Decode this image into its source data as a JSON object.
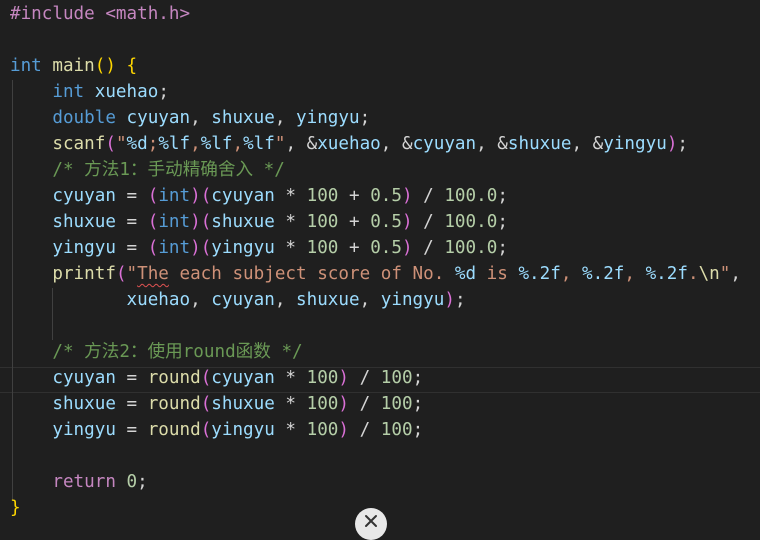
{
  "editor": {
    "colors": {
      "background": "#1f1f1f",
      "keyword": "#569cd6",
      "control": "#c586c0",
      "function": "#dcdcaa",
      "variable": "#9cdcfe",
      "string": "#ce9178",
      "number": "#b5cea8",
      "comment": "#6a9955",
      "bracket": "#ffd700",
      "bracket2": "#da70d6",
      "bracket3": "#179fff",
      "text": "#d4d4d4"
    },
    "lines": [
      [
        {
          "t": "#include <math.h>",
          "c": "control"
        }
      ],
      [],
      [
        {
          "t": "int",
          "c": "keyword"
        },
        {
          "t": " ",
          "c": "text"
        },
        {
          "t": "main",
          "c": "function"
        },
        {
          "t": "()",
          "c": "bracket"
        },
        {
          "t": " ",
          "c": "text"
        },
        {
          "t": "{",
          "c": "bracket"
        }
      ],
      [
        {
          "t": "    ",
          "c": "text"
        },
        {
          "t": "int",
          "c": "keyword"
        },
        {
          "t": " ",
          "c": "text"
        },
        {
          "t": "xuehao",
          "c": "variable"
        },
        {
          "t": ";",
          "c": "text"
        }
      ],
      [
        {
          "t": "    ",
          "c": "text"
        },
        {
          "t": "double",
          "c": "keyword"
        },
        {
          "t": " ",
          "c": "text"
        },
        {
          "t": "cyuyan",
          "c": "variable"
        },
        {
          "t": ", ",
          "c": "text"
        },
        {
          "t": "shuxue",
          "c": "variable"
        },
        {
          "t": ", ",
          "c": "text"
        },
        {
          "t": "yingyu",
          "c": "variable"
        },
        {
          "t": ";",
          "c": "text"
        }
      ],
      [
        {
          "t": "    ",
          "c": "text"
        },
        {
          "t": "scanf",
          "c": "function"
        },
        {
          "t": "(",
          "c": "bracket2"
        },
        {
          "t": "\"",
          "c": "string"
        },
        {
          "t": "%d",
          "c": "variable"
        },
        {
          "t": ";",
          "c": "string"
        },
        {
          "t": "%lf",
          "c": "variable"
        },
        {
          "t": ",",
          "c": "string"
        },
        {
          "t": "%lf",
          "c": "variable"
        },
        {
          "t": ",",
          "c": "string"
        },
        {
          "t": "%lf",
          "c": "variable"
        },
        {
          "t": "\"",
          "c": "string"
        },
        {
          "t": ", &",
          "c": "text"
        },
        {
          "t": "xuehao",
          "c": "variable"
        },
        {
          "t": ", &",
          "c": "text"
        },
        {
          "t": "cyuyan",
          "c": "variable"
        },
        {
          "t": ", &",
          "c": "text"
        },
        {
          "t": "shuxue",
          "c": "variable"
        },
        {
          "t": ", &",
          "c": "text"
        },
        {
          "t": "yingyu",
          "c": "variable"
        },
        {
          "t": ")",
          "c": "bracket2"
        },
        {
          "t": ";",
          "c": "text"
        }
      ],
      [
        {
          "t": "    ",
          "c": "text"
        },
        {
          "t": "/* 方法1：手动精确舍入 */",
          "c": "comment"
        }
      ],
      [
        {
          "t": "    ",
          "c": "text"
        },
        {
          "t": "cyuyan",
          "c": "variable"
        },
        {
          "t": " = ",
          "c": "text"
        },
        {
          "t": "(",
          "c": "bracket2"
        },
        {
          "t": "int",
          "c": "keyword"
        },
        {
          "t": ")",
          "c": "bracket2"
        },
        {
          "t": "(",
          "c": "bracket2"
        },
        {
          "t": "cyuyan",
          "c": "variable"
        },
        {
          "t": " * ",
          "c": "text"
        },
        {
          "t": "100",
          "c": "number"
        },
        {
          "t": " + ",
          "c": "text"
        },
        {
          "t": "0.5",
          "c": "number"
        },
        {
          "t": ")",
          "c": "bracket2"
        },
        {
          "t": " / ",
          "c": "text"
        },
        {
          "t": "100.0",
          "c": "number"
        },
        {
          "t": ";",
          "c": "text"
        }
      ],
      [
        {
          "t": "    ",
          "c": "text"
        },
        {
          "t": "shuxue",
          "c": "variable"
        },
        {
          "t": " = ",
          "c": "text"
        },
        {
          "t": "(",
          "c": "bracket2"
        },
        {
          "t": "int",
          "c": "keyword"
        },
        {
          "t": ")",
          "c": "bracket2"
        },
        {
          "t": "(",
          "c": "bracket2"
        },
        {
          "t": "shuxue",
          "c": "variable"
        },
        {
          "t": " * ",
          "c": "text"
        },
        {
          "t": "100",
          "c": "number"
        },
        {
          "t": " + ",
          "c": "text"
        },
        {
          "t": "0.5",
          "c": "number"
        },
        {
          "t": ")",
          "c": "bracket2"
        },
        {
          "t": " / ",
          "c": "text"
        },
        {
          "t": "100.0",
          "c": "number"
        },
        {
          "t": ";",
          "c": "text"
        }
      ],
      [
        {
          "t": "    ",
          "c": "text"
        },
        {
          "t": "yingyu",
          "c": "variable"
        },
        {
          "t": " = ",
          "c": "text"
        },
        {
          "t": "(",
          "c": "bracket2"
        },
        {
          "t": "int",
          "c": "keyword"
        },
        {
          "t": ")",
          "c": "bracket2"
        },
        {
          "t": "(",
          "c": "bracket2"
        },
        {
          "t": "yingyu",
          "c": "variable"
        },
        {
          "t": " * ",
          "c": "text"
        },
        {
          "t": "100",
          "c": "number"
        },
        {
          "t": " + ",
          "c": "text"
        },
        {
          "t": "0.5",
          "c": "number"
        },
        {
          "t": ")",
          "c": "bracket2"
        },
        {
          "t": " / ",
          "c": "text"
        },
        {
          "t": "100.0",
          "c": "number"
        },
        {
          "t": ";",
          "c": "text"
        }
      ],
      [
        {
          "t": "    ",
          "c": "text"
        },
        {
          "t": "printf",
          "c": "function"
        },
        {
          "t": "(",
          "c": "bracket2"
        },
        {
          "t": "\"",
          "c": "string"
        },
        {
          "t": "The",
          "c": "string",
          "squiggle": true
        },
        {
          "t": " each subject score of No. ",
          "c": "string"
        },
        {
          "t": "%d",
          "c": "variable"
        },
        {
          "t": " is ",
          "c": "string"
        },
        {
          "t": "%.2f",
          "c": "variable"
        },
        {
          "t": ", ",
          "c": "string"
        },
        {
          "t": "%.2f",
          "c": "variable"
        },
        {
          "t": ", ",
          "c": "string"
        },
        {
          "t": "%.2f",
          "c": "variable"
        },
        {
          "t": ".",
          "c": "string"
        },
        {
          "t": "\\n",
          "c": "function"
        },
        {
          "t": "\"",
          "c": "string"
        },
        {
          "t": ",",
          "c": "text"
        }
      ],
      [
        {
          "t": "           ",
          "c": "text"
        },
        {
          "t": "xuehao",
          "c": "variable"
        },
        {
          "t": ", ",
          "c": "text"
        },
        {
          "t": "cyuyan",
          "c": "variable"
        },
        {
          "t": ", ",
          "c": "text"
        },
        {
          "t": "shuxue",
          "c": "variable"
        },
        {
          "t": ", ",
          "c": "text"
        },
        {
          "t": "yingyu",
          "c": "variable"
        },
        {
          "t": ")",
          "c": "bracket2"
        },
        {
          "t": ";",
          "c": "text"
        }
      ],
      [],
      [
        {
          "t": "    ",
          "c": "text"
        },
        {
          "t": "/* 方法2：使用round函数 */",
          "c": "comment"
        }
      ],
      [
        {
          "t": "    ",
          "c": "text"
        },
        {
          "t": "cyuyan",
          "c": "variable"
        },
        {
          "t": " = ",
          "c": "text"
        },
        {
          "t": "round",
          "c": "function"
        },
        {
          "t": "(",
          "c": "bracket2"
        },
        {
          "t": "cyuyan",
          "c": "variable"
        },
        {
          "t": " * ",
          "c": "text"
        },
        {
          "t": "100",
          "c": "number"
        },
        {
          "t": ")",
          "c": "bracket2"
        },
        {
          "t": " / ",
          "c": "text"
        },
        {
          "t": "100",
          "c": "number"
        },
        {
          "t": ";",
          "c": "text"
        }
      ],
      [
        {
          "t": "    ",
          "c": "text"
        },
        {
          "t": "shuxue",
          "c": "variable"
        },
        {
          "t": " = ",
          "c": "text"
        },
        {
          "t": "round",
          "c": "function"
        },
        {
          "t": "(",
          "c": "bracket2"
        },
        {
          "t": "shuxue",
          "c": "variable"
        },
        {
          "t": " * ",
          "c": "text"
        },
        {
          "t": "100",
          "c": "number"
        },
        {
          "t": ")",
          "c": "bracket2"
        },
        {
          "t": " / ",
          "c": "text"
        },
        {
          "t": "100",
          "c": "number"
        },
        {
          "t": ";",
          "c": "text"
        }
      ],
      [
        {
          "t": "    ",
          "c": "text"
        },
        {
          "t": "yingyu",
          "c": "variable"
        },
        {
          "t": " = ",
          "c": "text"
        },
        {
          "t": "round",
          "c": "function"
        },
        {
          "t": "(",
          "c": "bracket2"
        },
        {
          "t": "yingyu",
          "c": "variable"
        },
        {
          "t": " * ",
          "c": "text"
        },
        {
          "t": "100",
          "c": "number"
        },
        {
          "t": ")",
          "c": "bracket2"
        },
        {
          "t": " / ",
          "c": "text"
        },
        {
          "t": "100",
          "c": "number"
        },
        {
          "t": ";",
          "c": "text"
        }
      ],
      [],
      [
        {
          "t": "    ",
          "c": "text"
        },
        {
          "t": "return",
          "c": "control"
        },
        {
          "t": " ",
          "c": "text"
        },
        {
          "t": "0",
          "c": "number"
        },
        {
          "t": ";",
          "c": "text"
        }
      ],
      [
        {
          "t": "}",
          "c": "bracket"
        }
      ]
    ]
  },
  "overlay": {
    "close_icon": "close-icon"
  }
}
